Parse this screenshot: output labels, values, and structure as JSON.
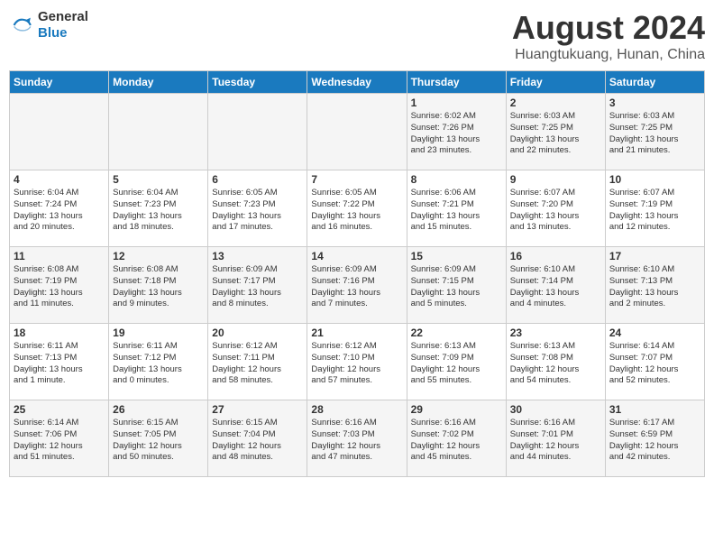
{
  "header": {
    "logo_line1": "General",
    "logo_line2": "Blue",
    "month": "August 2024",
    "location": "Huangtukuang, Hunan, China"
  },
  "weekdays": [
    "Sunday",
    "Monday",
    "Tuesday",
    "Wednesday",
    "Thursday",
    "Friday",
    "Saturday"
  ],
  "weeks": [
    [
      {
        "day": "",
        "info": ""
      },
      {
        "day": "",
        "info": ""
      },
      {
        "day": "",
        "info": ""
      },
      {
        "day": "",
        "info": ""
      },
      {
        "day": "1",
        "info": "Sunrise: 6:02 AM\nSunset: 7:26 PM\nDaylight: 13 hours\nand 23 minutes."
      },
      {
        "day": "2",
        "info": "Sunrise: 6:03 AM\nSunset: 7:25 PM\nDaylight: 13 hours\nand 22 minutes."
      },
      {
        "day": "3",
        "info": "Sunrise: 6:03 AM\nSunset: 7:25 PM\nDaylight: 13 hours\nand 21 minutes."
      }
    ],
    [
      {
        "day": "4",
        "info": "Sunrise: 6:04 AM\nSunset: 7:24 PM\nDaylight: 13 hours\nand 20 minutes."
      },
      {
        "day": "5",
        "info": "Sunrise: 6:04 AM\nSunset: 7:23 PM\nDaylight: 13 hours\nand 18 minutes."
      },
      {
        "day": "6",
        "info": "Sunrise: 6:05 AM\nSunset: 7:23 PM\nDaylight: 13 hours\nand 17 minutes."
      },
      {
        "day": "7",
        "info": "Sunrise: 6:05 AM\nSunset: 7:22 PM\nDaylight: 13 hours\nand 16 minutes."
      },
      {
        "day": "8",
        "info": "Sunrise: 6:06 AM\nSunset: 7:21 PM\nDaylight: 13 hours\nand 15 minutes."
      },
      {
        "day": "9",
        "info": "Sunrise: 6:07 AM\nSunset: 7:20 PM\nDaylight: 13 hours\nand 13 minutes."
      },
      {
        "day": "10",
        "info": "Sunrise: 6:07 AM\nSunset: 7:19 PM\nDaylight: 13 hours\nand 12 minutes."
      }
    ],
    [
      {
        "day": "11",
        "info": "Sunrise: 6:08 AM\nSunset: 7:19 PM\nDaylight: 13 hours\nand 11 minutes."
      },
      {
        "day": "12",
        "info": "Sunrise: 6:08 AM\nSunset: 7:18 PM\nDaylight: 13 hours\nand 9 minutes."
      },
      {
        "day": "13",
        "info": "Sunrise: 6:09 AM\nSunset: 7:17 PM\nDaylight: 13 hours\nand 8 minutes."
      },
      {
        "day": "14",
        "info": "Sunrise: 6:09 AM\nSunset: 7:16 PM\nDaylight: 13 hours\nand 7 minutes."
      },
      {
        "day": "15",
        "info": "Sunrise: 6:09 AM\nSunset: 7:15 PM\nDaylight: 13 hours\nand 5 minutes."
      },
      {
        "day": "16",
        "info": "Sunrise: 6:10 AM\nSunset: 7:14 PM\nDaylight: 13 hours\nand 4 minutes."
      },
      {
        "day": "17",
        "info": "Sunrise: 6:10 AM\nSunset: 7:13 PM\nDaylight: 13 hours\nand 2 minutes."
      }
    ],
    [
      {
        "day": "18",
        "info": "Sunrise: 6:11 AM\nSunset: 7:13 PM\nDaylight: 13 hours\nand 1 minute."
      },
      {
        "day": "19",
        "info": "Sunrise: 6:11 AM\nSunset: 7:12 PM\nDaylight: 13 hours\nand 0 minutes."
      },
      {
        "day": "20",
        "info": "Sunrise: 6:12 AM\nSunset: 7:11 PM\nDaylight: 12 hours\nand 58 minutes."
      },
      {
        "day": "21",
        "info": "Sunrise: 6:12 AM\nSunset: 7:10 PM\nDaylight: 12 hours\nand 57 minutes."
      },
      {
        "day": "22",
        "info": "Sunrise: 6:13 AM\nSunset: 7:09 PM\nDaylight: 12 hours\nand 55 minutes."
      },
      {
        "day": "23",
        "info": "Sunrise: 6:13 AM\nSunset: 7:08 PM\nDaylight: 12 hours\nand 54 minutes."
      },
      {
        "day": "24",
        "info": "Sunrise: 6:14 AM\nSunset: 7:07 PM\nDaylight: 12 hours\nand 52 minutes."
      }
    ],
    [
      {
        "day": "25",
        "info": "Sunrise: 6:14 AM\nSunset: 7:06 PM\nDaylight: 12 hours\nand 51 minutes."
      },
      {
        "day": "26",
        "info": "Sunrise: 6:15 AM\nSunset: 7:05 PM\nDaylight: 12 hours\nand 50 minutes."
      },
      {
        "day": "27",
        "info": "Sunrise: 6:15 AM\nSunset: 7:04 PM\nDaylight: 12 hours\nand 48 minutes."
      },
      {
        "day": "28",
        "info": "Sunrise: 6:16 AM\nSunset: 7:03 PM\nDaylight: 12 hours\nand 47 minutes."
      },
      {
        "day": "29",
        "info": "Sunrise: 6:16 AM\nSunset: 7:02 PM\nDaylight: 12 hours\nand 45 minutes."
      },
      {
        "day": "30",
        "info": "Sunrise: 6:16 AM\nSunset: 7:01 PM\nDaylight: 12 hours\nand 44 minutes."
      },
      {
        "day": "31",
        "info": "Sunrise: 6:17 AM\nSunset: 6:59 PM\nDaylight: 12 hours\nand 42 minutes."
      }
    ]
  ]
}
